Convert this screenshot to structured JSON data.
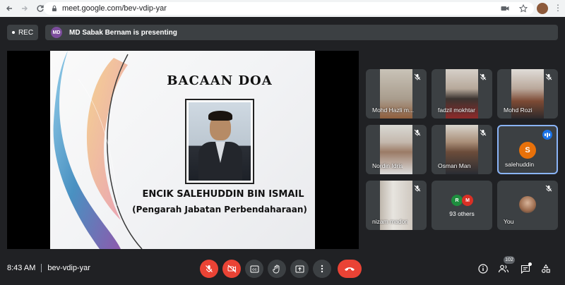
{
  "browser": {
    "url": "meet.google.com/bev-vdip-yar"
  },
  "meeting": {
    "rec_label": "REC",
    "presenter_initials": "MD",
    "presenting_text": "MD Sabak Bernam is presenting",
    "time": "8:43 AM",
    "meeting_code": "bev-vdip-yar",
    "participant_count": "102"
  },
  "slide": {
    "title": "BACAAN DOA",
    "name": "ENCIK SALEHUDDIN BIN ISMAIL",
    "subtitle": "(Pengarah Jabatan Perbendaharaan)"
  },
  "tiles": [
    {
      "name": "Mohd Hazli m...",
      "muted": true
    },
    {
      "name": "fadzil mokhtar",
      "muted": true
    },
    {
      "name": "Mohd Rozi",
      "muted": true
    },
    {
      "name": "Nordin Idris",
      "muted": true
    },
    {
      "name": "Osman Man",
      "muted": true
    },
    {
      "name": "salehuddin",
      "initial": "S",
      "speaking": true
    },
    {
      "name": "nizam madon",
      "muted": true
    },
    {
      "others_label": "93 others",
      "initials": [
        "R",
        "M"
      ]
    },
    {
      "name": "You",
      "muted": true
    }
  ],
  "colors": {
    "background": "#202124",
    "tile": "#3c4043",
    "red": "#ea4335",
    "accent_blue": "#1a73e8",
    "avatar_orange": "#e8710a"
  },
  "icons": [
    "back-icon",
    "forward-icon",
    "reload-icon",
    "lock-icon",
    "camera-icon",
    "star-icon",
    "more-icon",
    "mic-off-icon",
    "camera-off-icon",
    "captions-icon",
    "hand-icon",
    "present-icon",
    "more-options-icon",
    "hangup-icon",
    "info-icon",
    "people-icon",
    "chat-icon",
    "activities-icon"
  ]
}
